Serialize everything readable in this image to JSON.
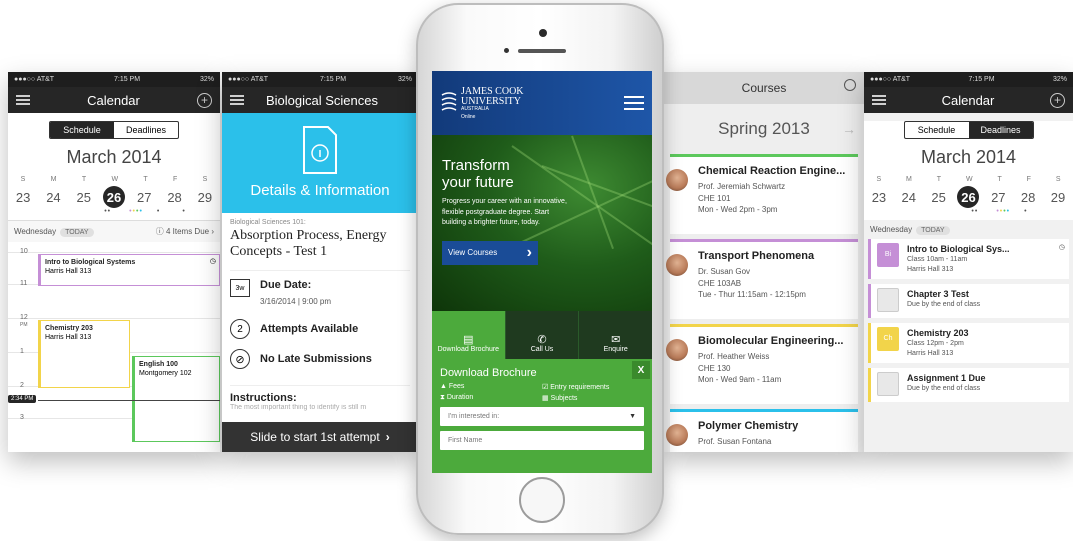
{
  "colors": {
    "purple": "#c58fd6",
    "yellow": "#f2d44a",
    "green": "#5cc85c",
    "cyan": "#2bc0ea",
    "jcu_blue": "#1a4c97",
    "jcu_green": "#4caa3c",
    "dark": "#262626"
  },
  "status": {
    "carrier": "●●●○○ AT&T",
    "time": "7:15 PM",
    "battery": "32%"
  },
  "left": {
    "title": "Calendar",
    "seg_schedule": "Schedule",
    "seg_deadlines": "Deadlines",
    "month": "March 2014",
    "weekdays": [
      "S",
      "M",
      "T",
      "W",
      "T",
      "F",
      "S"
    ],
    "dates": [
      "23",
      "24",
      "25",
      "26",
      "27",
      "28",
      "29"
    ],
    "day_label": "Wednesday",
    "today": "TODAY",
    "items_due": "4 Items Due",
    "hours": [
      "10",
      "11",
      "12",
      "1",
      "2",
      "3"
    ],
    "pm": "PM",
    "ev1_title": "Intro to Biological Systems",
    "ev1_place": "Harris Hall 313",
    "ev2_title": "Chemistry 203",
    "ev2_place": "Harris Hall 313",
    "ev3_title": "English 100",
    "ev3_place": "Montgomery 102",
    "now": "2:34 PM"
  },
  "bio": {
    "title": "Biological Sciences",
    "hero": "Details & Information",
    "sub": "Biological Sciences 101:",
    "heading": "Absorption Process, Energy Concepts - Test 1",
    "due_label": "Due Date:",
    "due_value": "3/16/2014 | 9:00 pm",
    "due_badge": "3w",
    "attempts_num": "2",
    "attempts": "Attempts Available",
    "no_late": "No Late Submissions",
    "instructions": "Instructions:",
    "instr_text": "The most important thing to identify is still m",
    "slide": "Slide to start 1st attempt"
  },
  "jcu": {
    "brand1": "JAMES COOK",
    "brand2": "UNIVERSITY",
    "brand3": "AUSTRALIA",
    "brand4": "Online",
    "hero1": "Transform",
    "hero2": "your future",
    "hero_text": "Progress your career with an innovative, flexible postgraduate degree. Start building a brighter future, today.",
    "cta": "View Courses",
    "b1": "Download Brochure",
    "b2": "Call Us",
    "b3": "Enquire",
    "form_title": "Download Brochure",
    "close": "X",
    "f1": "Fees",
    "f2": "Entry requirements",
    "f3": "Duration",
    "f4": "Subjects",
    "select_ph": "I'm interested in:",
    "name_ph": "First Name"
  },
  "courses": {
    "title": "Courses",
    "term": "Spring 2013",
    "items": [
      {
        "name": "Chemical Reaction Engine...",
        "prof": "Prof. Jeremiah Schwartz",
        "code": "CHE 101",
        "time": "Mon - Wed 2pm - 3pm",
        "color": "#5cc85c"
      },
      {
        "name": "Transport Phenomena",
        "prof": "Dr. Susan Gov",
        "code": "CHE 103AB",
        "time": "Tue - Thur 11:15am - 12:15pm",
        "color": "#c58fd6"
      },
      {
        "name": "Biomolecular Engineering...",
        "prof": "Prof. Heather Weiss",
        "code": "CHE 130",
        "time": "Mon - Wed 9am - 11am",
        "color": "#f2d44a"
      },
      {
        "name": "Polymer Chemistry",
        "prof": "Prof. Susan Fontana",
        "code": "",
        "time": "",
        "color": "#2bc0ea"
      }
    ]
  },
  "right": {
    "title": "Calendar",
    "seg_schedule": "Schedule",
    "seg_deadlines": "Deadlines",
    "month": "March 2014",
    "day_label": "Wednesday",
    "today": "TODAY",
    "items": [
      {
        "title": "Intro to Biological Sys...",
        "l1": "Class 10am - 11am",
        "l2": "Harris Hall 313",
        "icon": "Bi",
        "color": "#c58fd6"
      },
      {
        "title": "Chapter 3 Test",
        "l1": "Due by the end of class",
        "l2": "",
        "icon": "",
        "color": "#c58fd6"
      },
      {
        "title": "Chemistry 203",
        "l1": "Class 12pm - 2pm",
        "l2": "Harris Hall 313",
        "icon": "Ch",
        "color": "#f2d44a"
      },
      {
        "title": "Assignment 1 Due",
        "l1": "Due by the end of class",
        "l2": "",
        "icon": "",
        "color": "#f2d44a"
      }
    ]
  }
}
